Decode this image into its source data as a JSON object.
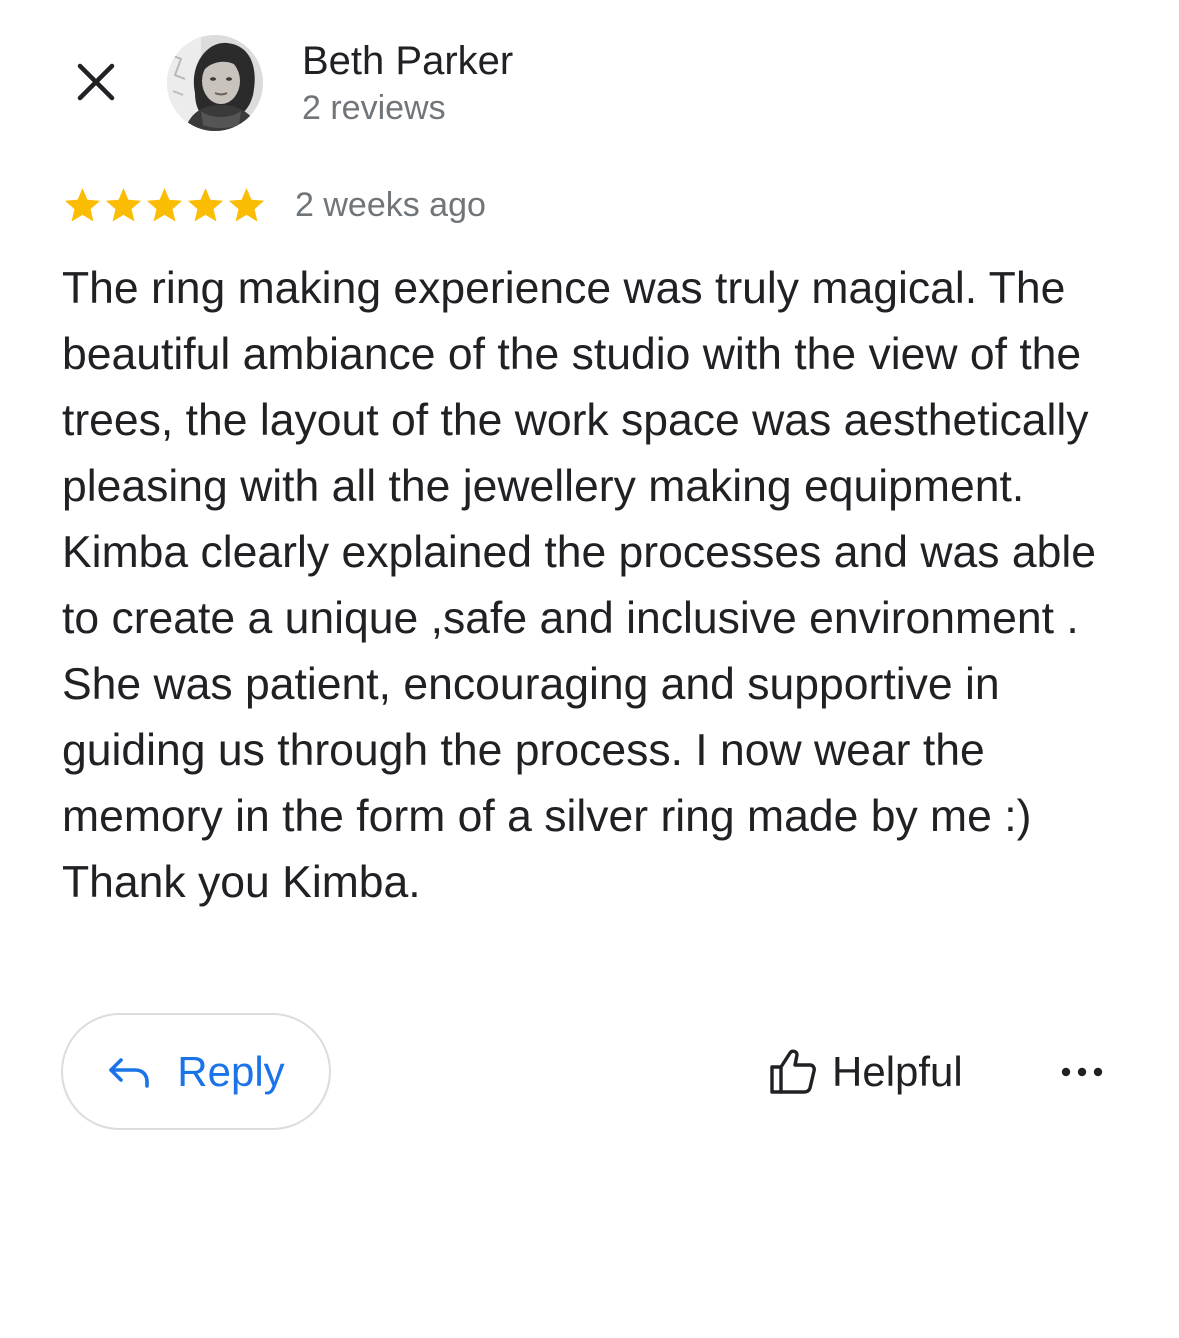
{
  "header": {
    "author_name": "Beth Parker",
    "author_meta": "2 reviews",
    "close_icon": "close-icon",
    "avatar": "profile-photo"
  },
  "rating": {
    "stars": 5,
    "max_stars": 5,
    "star_color": "#fbbc04",
    "time_ago": "2 weeks ago"
  },
  "review": {
    "text": "The ring making experience was truly magical. The beautiful ambiance of the studio with the view of the trees, the layout of the work space was aesthetically pleasing with all the jewellery making equipment. Kimba clearly explained the processes and was able to create a unique ,safe and inclusive environment . She was patient, encouraging and supportive in guiding us through the process. I now wear the memory in the form of a silver ring made by me :) Thank you Kimba."
  },
  "actions": {
    "reply_label": "Reply",
    "reply_icon": "reply-arrow-icon",
    "reply_color": "#1a73e8",
    "helpful_label": "Helpful",
    "helpful_icon": "thumbs-up-icon",
    "more_icon": "more-horizontal-icon"
  }
}
